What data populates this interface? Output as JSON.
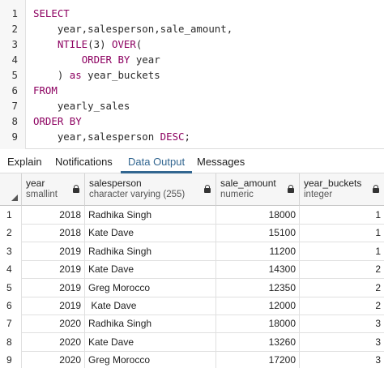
{
  "editor": {
    "lines": [
      {
        "num": "1",
        "parts": [
          {
            "t": "SELECT",
            "c": "kw"
          }
        ]
      },
      {
        "num": "2",
        "parts": [
          {
            "t": "    year,salesperson,sale_amount,",
            "c": "pl"
          }
        ]
      },
      {
        "num": "3",
        "parts": [
          {
            "t": "    ",
            "c": "pl"
          },
          {
            "t": "NTILE",
            "c": "fn"
          },
          {
            "t": "(3) ",
            "c": "pl"
          },
          {
            "t": "OVER",
            "c": "kw"
          },
          {
            "t": "(",
            "c": "pl"
          }
        ]
      },
      {
        "num": "4",
        "parts": [
          {
            "t": "        ",
            "c": "pl"
          },
          {
            "t": "ORDER BY",
            "c": "kw"
          },
          {
            "t": " year",
            "c": "pl"
          }
        ]
      },
      {
        "num": "5",
        "parts": [
          {
            "t": "    ) ",
            "c": "pl"
          },
          {
            "t": "as",
            "c": "kw"
          },
          {
            "t": " year_buckets",
            "c": "pl"
          }
        ]
      },
      {
        "num": "6",
        "parts": [
          {
            "t": "FROM",
            "c": "kw"
          }
        ]
      },
      {
        "num": "7",
        "parts": [
          {
            "t": "    yearly_sales",
            "c": "pl"
          }
        ]
      },
      {
        "num": "8",
        "parts": [
          {
            "t": "ORDER BY",
            "c": "kw"
          }
        ]
      },
      {
        "num": "9",
        "parts": [
          {
            "t": "    year,salesperson ",
            "c": "pl"
          },
          {
            "t": "DESC",
            "c": "kw"
          },
          {
            "t": ";",
            "c": "pl"
          }
        ]
      }
    ]
  },
  "tabs": [
    {
      "label": "Explain",
      "active": false
    },
    {
      "label": "Notifications",
      "active": false
    },
    {
      "label": "Data Output",
      "active": true
    },
    {
      "label": "Messages",
      "active": false
    }
  ],
  "grid": {
    "columns": [
      {
        "name": "year",
        "type": "smallint"
      },
      {
        "name": "salesperson",
        "type": "character varying (255)"
      },
      {
        "name": "sale_amount",
        "type": "numeric"
      },
      {
        "name": "year_buckets",
        "type": "integer"
      }
    ],
    "rows": [
      {
        "n": "1",
        "year": "2018",
        "salesperson": "Radhika Singh",
        "sale_amount": "18000",
        "year_buckets": "1"
      },
      {
        "n": "2",
        "year": "2018",
        "salesperson": "Kate Dave",
        "sale_amount": "15100",
        "year_buckets": "1"
      },
      {
        "n": "3",
        "year": "2019",
        "salesperson": "Radhika Singh",
        "sale_amount": "11200",
        "year_buckets": "1"
      },
      {
        "n": "4",
        "year": "2019",
        "salesperson": "Kate Dave",
        "sale_amount": "14300",
        "year_buckets": "2"
      },
      {
        "n": "5",
        "year": "2019",
        "salesperson": "Greg Morocco",
        "sale_amount": "12350",
        "year_buckets": "2"
      },
      {
        "n": "6",
        "year": "2019",
        "salesperson": " Kate Dave",
        "sale_amount": "12000",
        "year_buckets": "2"
      },
      {
        "n": "7",
        "year": "2020",
        "salesperson": "Radhika Singh",
        "sale_amount": "18000",
        "year_buckets": "3"
      },
      {
        "n": "8",
        "year": "2020",
        "salesperson": "Kate Dave",
        "sale_amount": "13260",
        "year_buckets": "3"
      },
      {
        "n": "9",
        "year": "2020",
        "salesperson": "Greg Morocco",
        "sale_amount": "17200",
        "year_buckets": "3"
      }
    ]
  }
}
